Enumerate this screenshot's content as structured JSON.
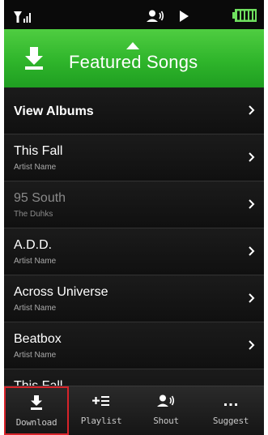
{
  "header": {
    "title": "Featured Songs"
  },
  "list": {
    "items": [
      {
        "title": "View Albums",
        "subtitle": "",
        "bold": true,
        "dim": false
      },
      {
        "title": "This Fall",
        "subtitle": "Artist Name",
        "bold": false,
        "dim": false
      },
      {
        "title": "95 South",
        "subtitle": "The Duhks",
        "bold": false,
        "dim": true
      },
      {
        "title": "A.D.D.",
        "subtitle": "Artist Name",
        "bold": false,
        "dim": false
      },
      {
        "title": "Across Universe",
        "subtitle": "Artist Name",
        "bold": false,
        "dim": false
      },
      {
        "title": "Beatbox",
        "subtitle": "Artist Name",
        "bold": false,
        "dim": false
      },
      {
        "title": "This Fall",
        "subtitle": "",
        "bold": false,
        "dim": false
      }
    ]
  },
  "toolbar": {
    "download_label": "Download",
    "playlist_label": "Playlist",
    "shout_label": "Shout",
    "suggest_label": "Suggest",
    "selected": "download"
  },
  "status": {
    "icons": [
      "signal-icon",
      "shout-icon",
      "play-icon",
      "battery-icon"
    ]
  },
  "colors": {
    "header_green": "#2fb52b",
    "highlight_red": "#d8232a",
    "background": "#0f0f0f"
  }
}
